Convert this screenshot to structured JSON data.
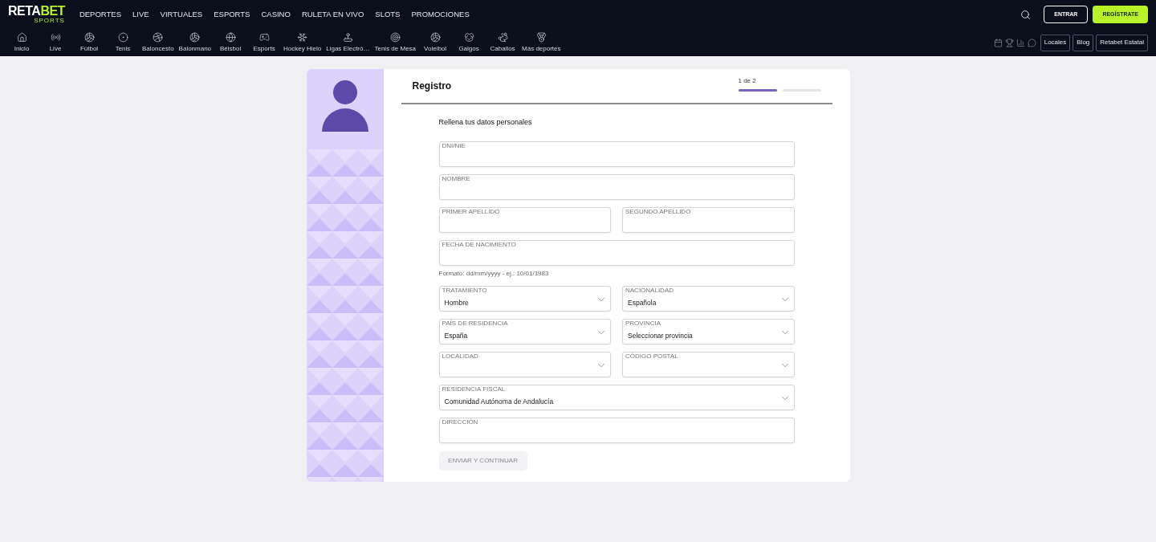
{
  "logo": {
    "part1": "RETA",
    "part2": "BET",
    "sub": "SPORTS"
  },
  "main_nav": [
    "DEPORTES",
    "LIVE",
    "VIRTUALES",
    "ESPORTS",
    "CASINO",
    "RULETA EN VIVO",
    "SLOTS",
    "PROMOCIONES"
  ],
  "auth_buttons": [
    {
      "label": "ENTRAR",
      "kind": "outline"
    },
    {
      "label": "REGÍSTRATE",
      "kind": "primary"
    }
  ],
  "sports_nav": [
    "Inicio",
    "Live",
    "Fútbol",
    "Tenis",
    "Baloncesto",
    "Balonmano",
    "Béisbol",
    "Esports",
    "Hockey Hielo",
    "Ligas Electró…",
    "Tenis de Mesa",
    "Voleibol",
    "Galgos",
    "Caballos",
    "Más deportes"
  ],
  "links": [
    "Locales",
    "Blog",
    "Retabet Estatal"
  ],
  "registration": {
    "title": "Registro",
    "step_label": "1 de 2",
    "steps": [
      {
        "active": true
      },
      {
        "active": false
      }
    ],
    "subtitle": "Rellena tus datos personales",
    "rows": [
      [
        {
          "label": "DNI/NIE",
          "kind": "text"
        }
      ],
      [
        {
          "label": "NOMBRE",
          "kind": "text"
        }
      ],
      [
        {
          "label": "PRIMER APELLIDO",
          "kind": "text"
        },
        {
          "label": "SEGUNDO APELLIDO",
          "kind": "text"
        }
      ],
      [
        {
          "label": "FECHA DE NACIMIENTO",
          "kind": "text",
          "hint": "Formato: dd/mm/yyyy - ej.: 10/01/1983"
        }
      ],
      [
        {
          "label": "TRATAMIENTO",
          "kind": "select",
          "value": "Hombre"
        },
        {
          "label": "NACIONALIDAD",
          "kind": "select",
          "value": "Española"
        }
      ],
      [
        {
          "label": "PAÍS DE RESIDENCIA",
          "kind": "select",
          "value": "España"
        },
        {
          "label": "PROVINCIA",
          "kind": "select",
          "value": "Seleccionar provincia"
        }
      ],
      [
        {
          "label": "LOCALIDAD",
          "kind": "select"
        },
        {
          "label": "CÓDIGO POSTAL",
          "kind": "select"
        }
      ],
      [
        {
          "label": "RESIDENCIA FISCAL",
          "kind": "select",
          "value": "Comunidad Autónoma de Andalucía"
        }
      ],
      [
        {
          "label": "DIRECCIÓN",
          "kind": "text"
        }
      ]
    ],
    "submit": {
      "label": "ENVIAR Y CONTINUAR",
      "disabled": true
    }
  }
}
